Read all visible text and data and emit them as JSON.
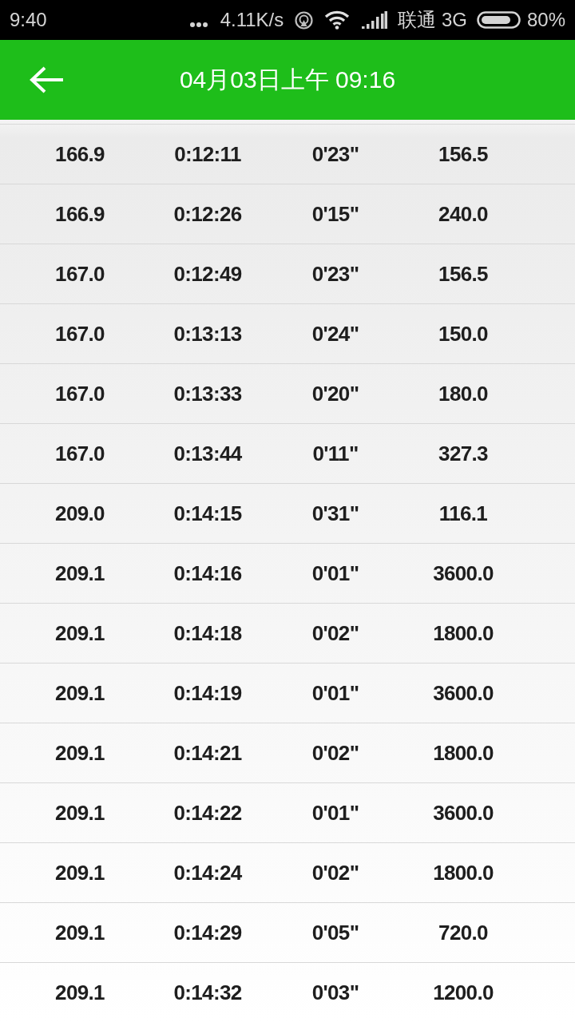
{
  "status_bar": {
    "time": "9:40",
    "network_speed": "4.11K/s",
    "carrier": "联通 3G",
    "battery": "80%"
  },
  "app_bar": {
    "title": "04月03日上午 09:16"
  },
  "rows": [
    [
      "166.9",
      "0:12:11",
      "0'23\"",
      "156.5"
    ],
    [
      "166.9",
      "0:12:26",
      "0'15\"",
      "240.0"
    ],
    [
      "167.0",
      "0:12:49",
      "0'23\"",
      "156.5"
    ],
    [
      "167.0",
      "0:13:13",
      "0'24\"",
      "150.0"
    ],
    [
      "167.0",
      "0:13:33",
      "0'20\"",
      "180.0"
    ],
    [
      "167.0",
      "0:13:44",
      "0'11\"",
      "327.3"
    ],
    [
      "209.0",
      "0:14:15",
      "0'31\"",
      "116.1"
    ],
    [
      "209.1",
      "0:14:16",
      "0'01\"",
      "3600.0"
    ],
    [
      "209.1",
      "0:14:18",
      "0'02\"",
      "1800.0"
    ],
    [
      "209.1",
      "0:14:19",
      "0'01\"",
      "3600.0"
    ],
    [
      "209.1",
      "0:14:21",
      "0'02\"",
      "1800.0"
    ],
    [
      "209.1",
      "0:14:22",
      "0'01\"",
      "3600.0"
    ],
    [
      "209.1",
      "0:14:24",
      "0'02\"",
      "1800.0"
    ],
    [
      "209.1",
      "0:14:29",
      "0'05\"",
      "720.0"
    ],
    [
      "209.1",
      "0:14:32",
      "0'03\"",
      "1200.0"
    ]
  ]
}
